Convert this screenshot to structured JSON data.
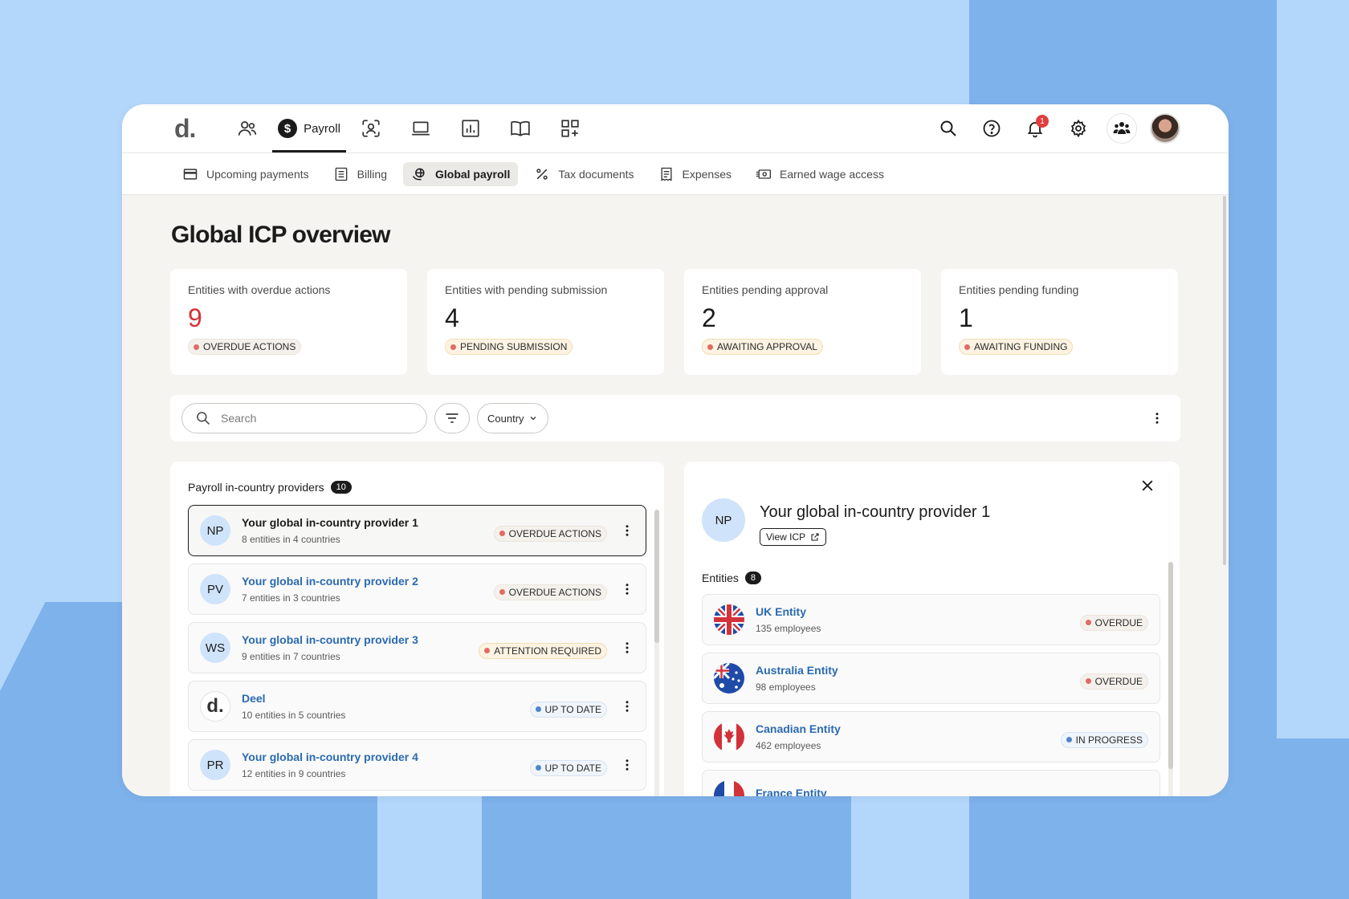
{
  "brand": {
    "logo": "d."
  },
  "nav": {
    "active_label": "Payroll",
    "items": [
      "people-icon",
      "payroll-dollar-icon",
      "user-scan-icon",
      "laptop-icon",
      "chart-icon",
      "book-icon",
      "apps-icon"
    ]
  },
  "topbar": {
    "notification_count": "1"
  },
  "subnav": {
    "items": [
      {
        "label": "Upcoming payments",
        "icon": "card-icon"
      },
      {
        "label": "Billing",
        "icon": "document-icon"
      },
      {
        "label": "Global payroll",
        "icon": "globe-hand-icon",
        "active": true
      },
      {
        "label": "Tax documents",
        "icon": "percent-icon"
      },
      {
        "label": "Expenses",
        "icon": "receipt-icon"
      },
      {
        "label": "Earned wage access",
        "icon": "cash-icon"
      }
    ]
  },
  "page": {
    "title": "Global ICP overview"
  },
  "cards": [
    {
      "label": "Entities with overdue actions",
      "value": "9",
      "status": "OVERDUE ACTIONS"
    },
    {
      "label": "Entities with pending submission",
      "value": "4",
      "status": "PENDING SUBMISSION"
    },
    {
      "label": "Entities pending approval",
      "value": "2",
      "status": "AWAITING APPROVAL"
    },
    {
      "label": "Entities pending funding",
      "value": "1",
      "status": "AWAITING FUNDING"
    }
  ],
  "toolbar": {
    "search_placeholder": "Search",
    "country_label": "Country"
  },
  "providers": {
    "title": "Payroll in-country providers",
    "count": "10",
    "items": [
      {
        "initials": "NP",
        "name": "Your global in-country provider 1",
        "sub": "8 entities in 4 countries",
        "status": "OVERDUE ACTIONS"
      },
      {
        "initials": "PV",
        "name": "Your global in-country provider 2",
        "sub": "7 entities in 3 countries",
        "status": "OVERDUE ACTIONS"
      },
      {
        "initials": "WS",
        "name": "Your global in-country provider 3",
        "sub": "9 entities in 7 countries",
        "status": "ATTENTION REQUIRED"
      },
      {
        "initials": "d.",
        "name": "Deel",
        "sub": "10 entities in 5 countries",
        "status": "UP TO DATE"
      },
      {
        "initials": "PR",
        "name": "Your global in-country provider 4",
        "sub": "12 entities in 9 countries",
        "status": "UP TO DATE"
      }
    ]
  },
  "detail": {
    "initials": "NP",
    "title": "Your global in-country provider 1",
    "view_label": "View ICP",
    "entities_title": "Entities",
    "entities_count": "8",
    "entities": [
      {
        "name": "UK Entity",
        "sub": "135 employees",
        "status": "OVERDUE"
      },
      {
        "name": "Australia Entity",
        "sub": "98 employees",
        "status": "OVERDUE"
      },
      {
        "name": "Canadian Entity",
        "sub": "462 employees",
        "status": "IN PROGRESS"
      },
      {
        "name": "France Entity",
        "sub": "",
        "status": ""
      }
    ]
  },
  "colors": {
    "accent_link": "#2a6ab0",
    "danger": "#d2323a",
    "background": "#b3d7fb"
  }
}
